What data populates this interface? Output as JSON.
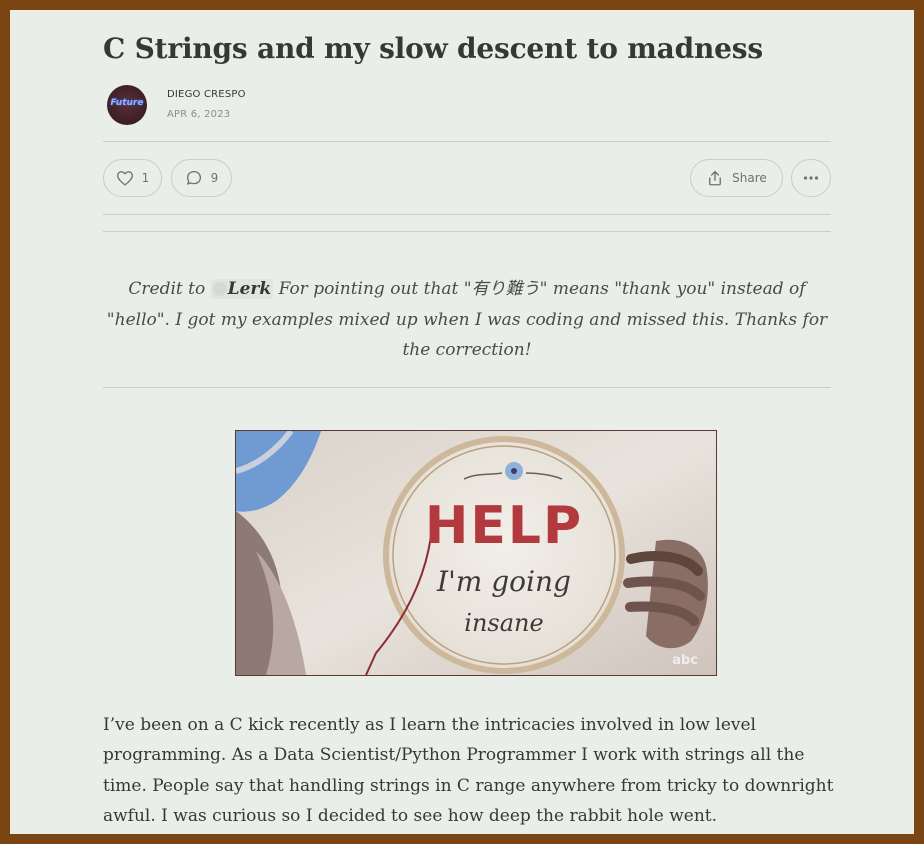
{
  "post": {
    "title": "C Strings and my slow descent to madness",
    "author": "DIEGO CRESPO",
    "date": "APR 6, 2023",
    "avatar_text": "Future"
  },
  "actions": {
    "like_count": "1",
    "comment_count": "9",
    "share_label": "Share",
    "icons": [
      "heart-icon",
      "comment-icon",
      "share-icon",
      "more-icon"
    ]
  },
  "callout": {
    "prefix": "Credit to",
    "mention": "Lerk",
    "text": "For pointing out that \"有り難う\" means \"thank you\" instead of \"hello\". I got my examples mixed up when I was coding and missed this. Thanks for the correction!"
  },
  "figure": {
    "line1": "HELP",
    "line2": "I'm going",
    "line3": "insane",
    "watermark": "abc"
  },
  "body": {
    "paragraph1": "I’ve been on a C kick recently as I learn the intricacies involved in low level programming. As a Data Scientist/Python Programmer I work with strings all the time. People say that handling strings in C range anywhere from tricky to downright awful. I was curious so I decided to see how deep the rabbit hole went."
  },
  "colors": {
    "page_background": "#e9efe8",
    "frame": "#7a4512",
    "text": "#363737",
    "muted": "#8b8d8d",
    "help_red": "#b23a3f"
  }
}
